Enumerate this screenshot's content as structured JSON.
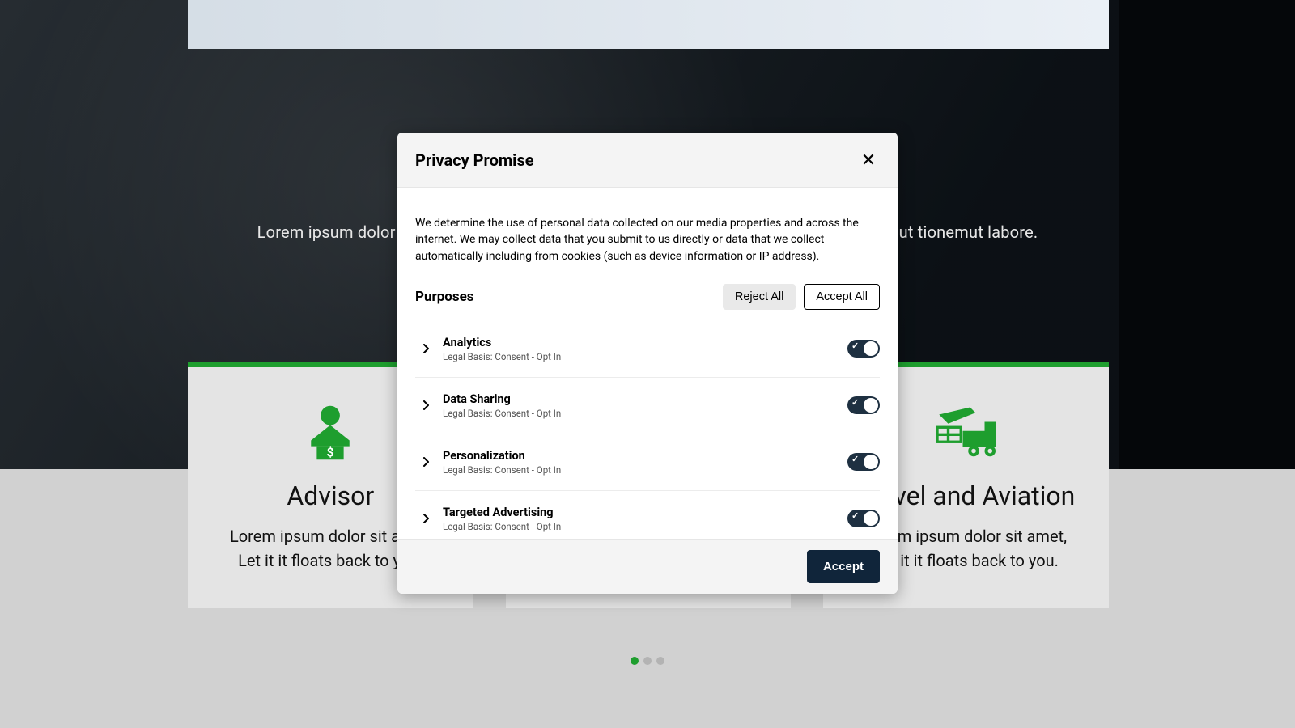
{
  "background": {
    "subtitle": "Lorem ipsum dolor sit amet, consectetur adipisicing elit, sed do eiusmod tempor incididut tionemut labore.",
    "cards": [
      {
        "title": "Advisor",
        "text": "Lorem ipsum dolor sit amet, Let it it floats back to you."
      },
      {
        "title": "",
        "text": ""
      },
      {
        "title": "Travel and Aviation",
        "text": "Lorem ipsum dolor sit amet, Let it it floats back to you."
      }
    ],
    "pager": {
      "count": 3,
      "active_index": 0
    }
  },
  "modal": {
    "title": "Privacy Promise",
    "intro": "We determine the use of personal data collected on our media properties and across the internet. We may collect data that you submit to us directly or data that we collect automatically including from cookies (such as device information or IP address).",
    "purposes_label": "Purposes",
    "reject_all_label": "Reject All",
    "accept_all_label": "Accept All",
    "accept_label": "Accept",
    "purposes": [
      {
        "name": "Analytics",
        "basis": "Legal Basis: Consent - Opt In",
        "enabled": true
      },
      {
        "name": "Data Sharing",
        "basis": "Legal Basis: Consent - Opt In",
        "enabled": true
      },
      {
        "name": "Personalization",
        "basis": "Legal Basis: Consent - Opt In",
        "enabled": true
      },
      {
        "name": "Targeted Advertising",
        "basis": "Legal Basis: Consent - Opt In",
        "enabled": true
      }
    ]
  }
}
